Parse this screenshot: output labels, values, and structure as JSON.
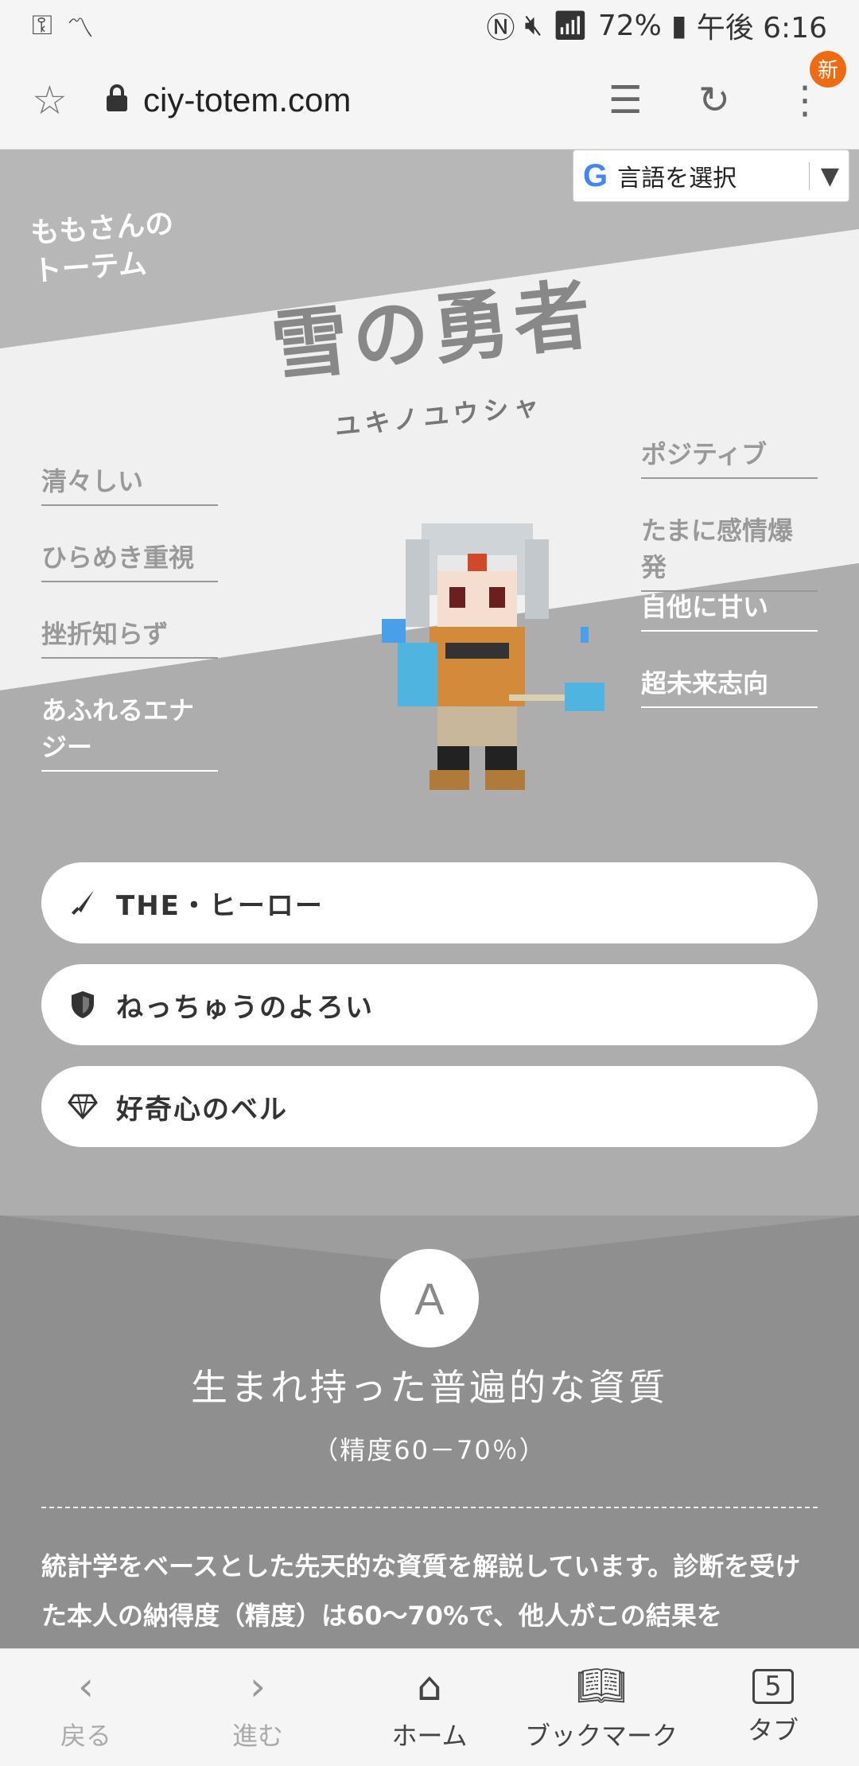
{
  "status_bar": {
    "left_icons": [
      "key-icon",
      "activity-icon"
    ],
    "battery": "72%",
    "time": "午後 6:16"
  },
  "browser": {
    "url": "ciy-totem.com",
    "new_badge": "新"
  },
  "translate": {
    "label": "言語を選択",
    "logo": "G"
  },
  "site": {
    "title_line1": "ももさんの",
    "title_line2": "トーテム"
  },
  "hero": {
    "title": "雪の勇者",
    "kana": "ユキノユウシャ"
  },
  "traits_left": [
    "清々しい",
    "ひらめき重視",
    "挫折知らず",
    "あふれるエナジー"
  ],
  "traits_right": [
    "ポジティブ",
    "たまに感情爆発",
    "自他に甘い",
    "超未来志向"
  ],
  "pills": [
    {
      "icon": "sword-icon",
      "label": "THE・ヒーロー"
    },
    {
      "icon": "shield-icon",
      "label": "ねっちゅうのよろい"
    },
    {
      "icon": "diamond-icon",
      "label": "好奇心のベル"
    }
  ],
  "grade": {
    "letter": "A",
    "title": "生まれ持った普遍的な資質",
    "subtitle": "（精度60－70％）",
    "description": "統計学をベースとした先天的な資質を解説しています。診断を受けた本人の納得度（精度）は60〜70%で、他人がこの結果を"
  },
  "bottom_nav": [
    {
      "icon": "back-icon",
      "label": "戻る"
    },
    {
      "icon": "forward-icon",
      "label": "進む"
    },
    {
      "icon": "home-icon",
      "label": "ホーム"
    },
    {
      "icon": "bookmark-icon",
      "label": "ブックマーク"
    },
    {
      "icon": "tabs-icon",
      "label": "タブ",
      "count": "5"
    }
  ]
}
